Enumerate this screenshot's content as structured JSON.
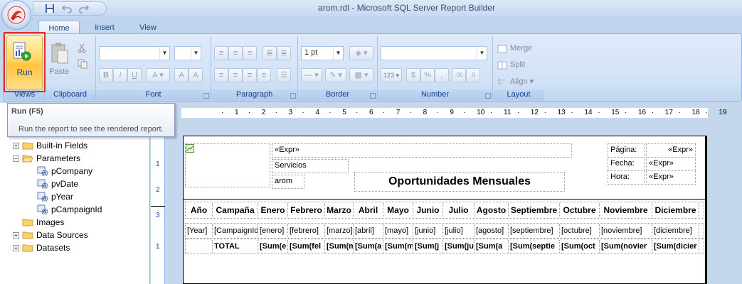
{
  "window": {
    "title": "arom.rdl - Microsoft SQL Server Report Builder"
  },
  "tabs": [
    {
      "label": "Home"
    },
    {
      "label": "Insert"
    },
    {
      "label": "View"
    }
  ],
  "ribbon": {
    "run_label": "Run",
    "paste_label": "Paste",
    "border_width": "1 pt",
    "merge_label": "Merge",
    "split_label": "Split",
    "align_label": "Align",
    "groups": {
      "views": "Views",
      "clipboard": "Clipboard",
      "font": "Font",
      "paragraph": "Paragraph",
      "border": "Border",
      "number": "Number",
      "layout": "Layout"
    }
  },
  "tooltip": {
    "title": "Run (F5)",
    "description": "Run the report to see the rendered report."
  },
  "tree": {
    "items": [
      {
        "label": "Built-in Fields",
        "type": "folder",
        "expander": "+"
      },
      {
        "label": "Parameters",
        "type": "folder-open",
        "expander": "−"
      },
      {
        "label": "pCompany",
        "type": "param"
      },
      {
        "label": "pvDate",
        "type": "param"
      },
      {
        "label": "pYear",
        "type": "param"
      },
      {
        "label": "pCampaignId",
        "type": "param"
      },
      {
        "label": "Images",
        "type": "folder",
        "expander": ""
      },
      {
        "label": "Data Sources",
        "type": "folder",
        "expander": "+"
      },
      {
        "label": "Datasets",
        "type": "folder",
        "expander": "+"
      }
    ]
  },
  "ruler": {
    "ticks": [
      "1",
      "2",
      "3",
      "4",
      "5",
      "6",
      "7",
      "8",
      "9",
      "10",
      "11",
      "12",
      "13",
      "14",
      "15",
      "16",
      "17",
      "18",
      "19"
    ]
  },
  "vruler": {
    "ticks": [
      "1",
      "2",
      "3",
      "1"
    ]
  },
  "report": {
    "header_expr": "«Expr»",
    "servicios": "Servicios",
    "arom": "arom",
    "title": "Oportunidades Mensuales",
    "pagina_label": "Página:",
    "pagina_expr": "«Expr»",
    "fecha_label": "Fecha:",
    "fecha_expr": "«Expr»",
    "hora_label": "Hora:",
    "hora_expr": "«Expr»",
    "columns": [
      "Año",
      "Campaña",
      "Enero",
      "Febrero",
      "Marzo",
      "Abril",
      "Mayo",
      "Junio",
      "Julio",
      "Agosto",
      "Septiembre",
      "Octubre",
      "Noviembre",
      "Diciembre"
    ],
    "detail_row": [
      "[Year]",
      "[CampaignId",
      "[enero]",
      "[febrero]",
      "[marzo]",
      "[abril]",
      "[mayo]",
      "[junio]",
      "[julio]",
      "[agosto]",
      "[septiembre]",
      "[octubre]",
      "[noviembre]",
      "[diciembre]"
    ],
    "total_row": [
      "",
      "TOTAL",
      "[Sum(e",
      "[Sum(fel",
      "[Sum(m",
      "[Sum(a",
      "[Sum(m",
      "[Sum(j",
      "[Sum(ju",
      "[Sum(a",
      "[Sum(septie",
      "[Sum(oct",
      "[Sum(novier",
      "[Sum(dicier"
    ]
  }
}
